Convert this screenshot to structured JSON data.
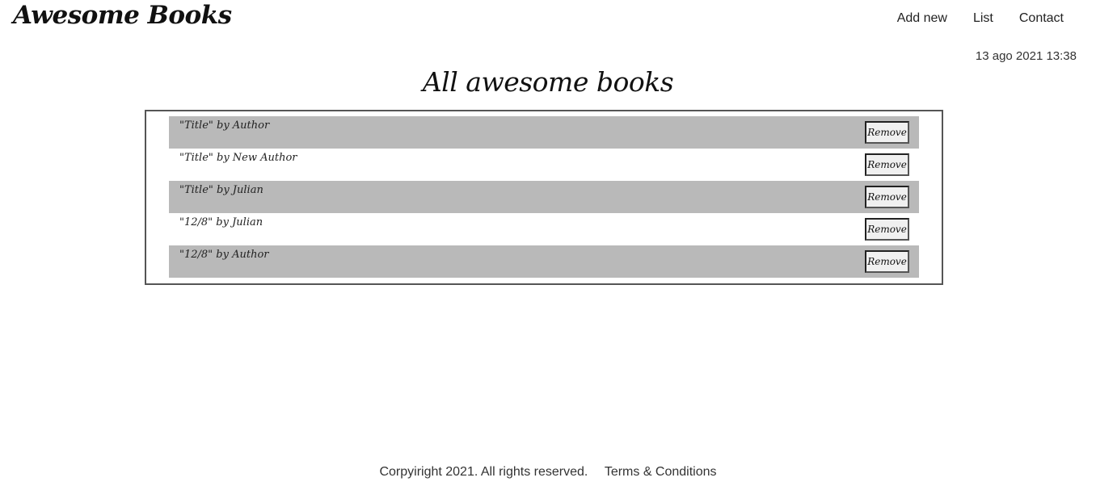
{
  "header": {
    "brand": "Awesome Books",
    "nav": [
      {
        "label": "Add new"
      },
      {
        "label": "List"
      },
      {
        "label": "Contact"
      }
    ],
    "datetime": "13 ago 2021 13:38"
  },
  "main": {
    "title": "All awesome books",
    "books": [
      {
        "text": "\"Title\" by Author",
        "remove_label": "Remove"
      },
      {
        "text": "\"Title\" by New Author",
        "remove_label": "Remove"
      },
      {
        "text": "\"Title\" by Julian",
        "remove_label": "Remove"
      },
      {
        "text": "\"12/8\" by Julian",
        "remove_label": "Remove"
      },
      {
        "text": "\"12/8\" by Author",
        "remove_label": "Remove"
      }
    ]
  },
  "footer": {
    "copyright": "Corpyiright 2021. All rights reserved.",
    "terms_link": "Terms & Conditions"
  },
  "colors": {
    "row_shade": "#b9b9b9",
    "border": "#555555",
    "text": "#222222"
  }
}
